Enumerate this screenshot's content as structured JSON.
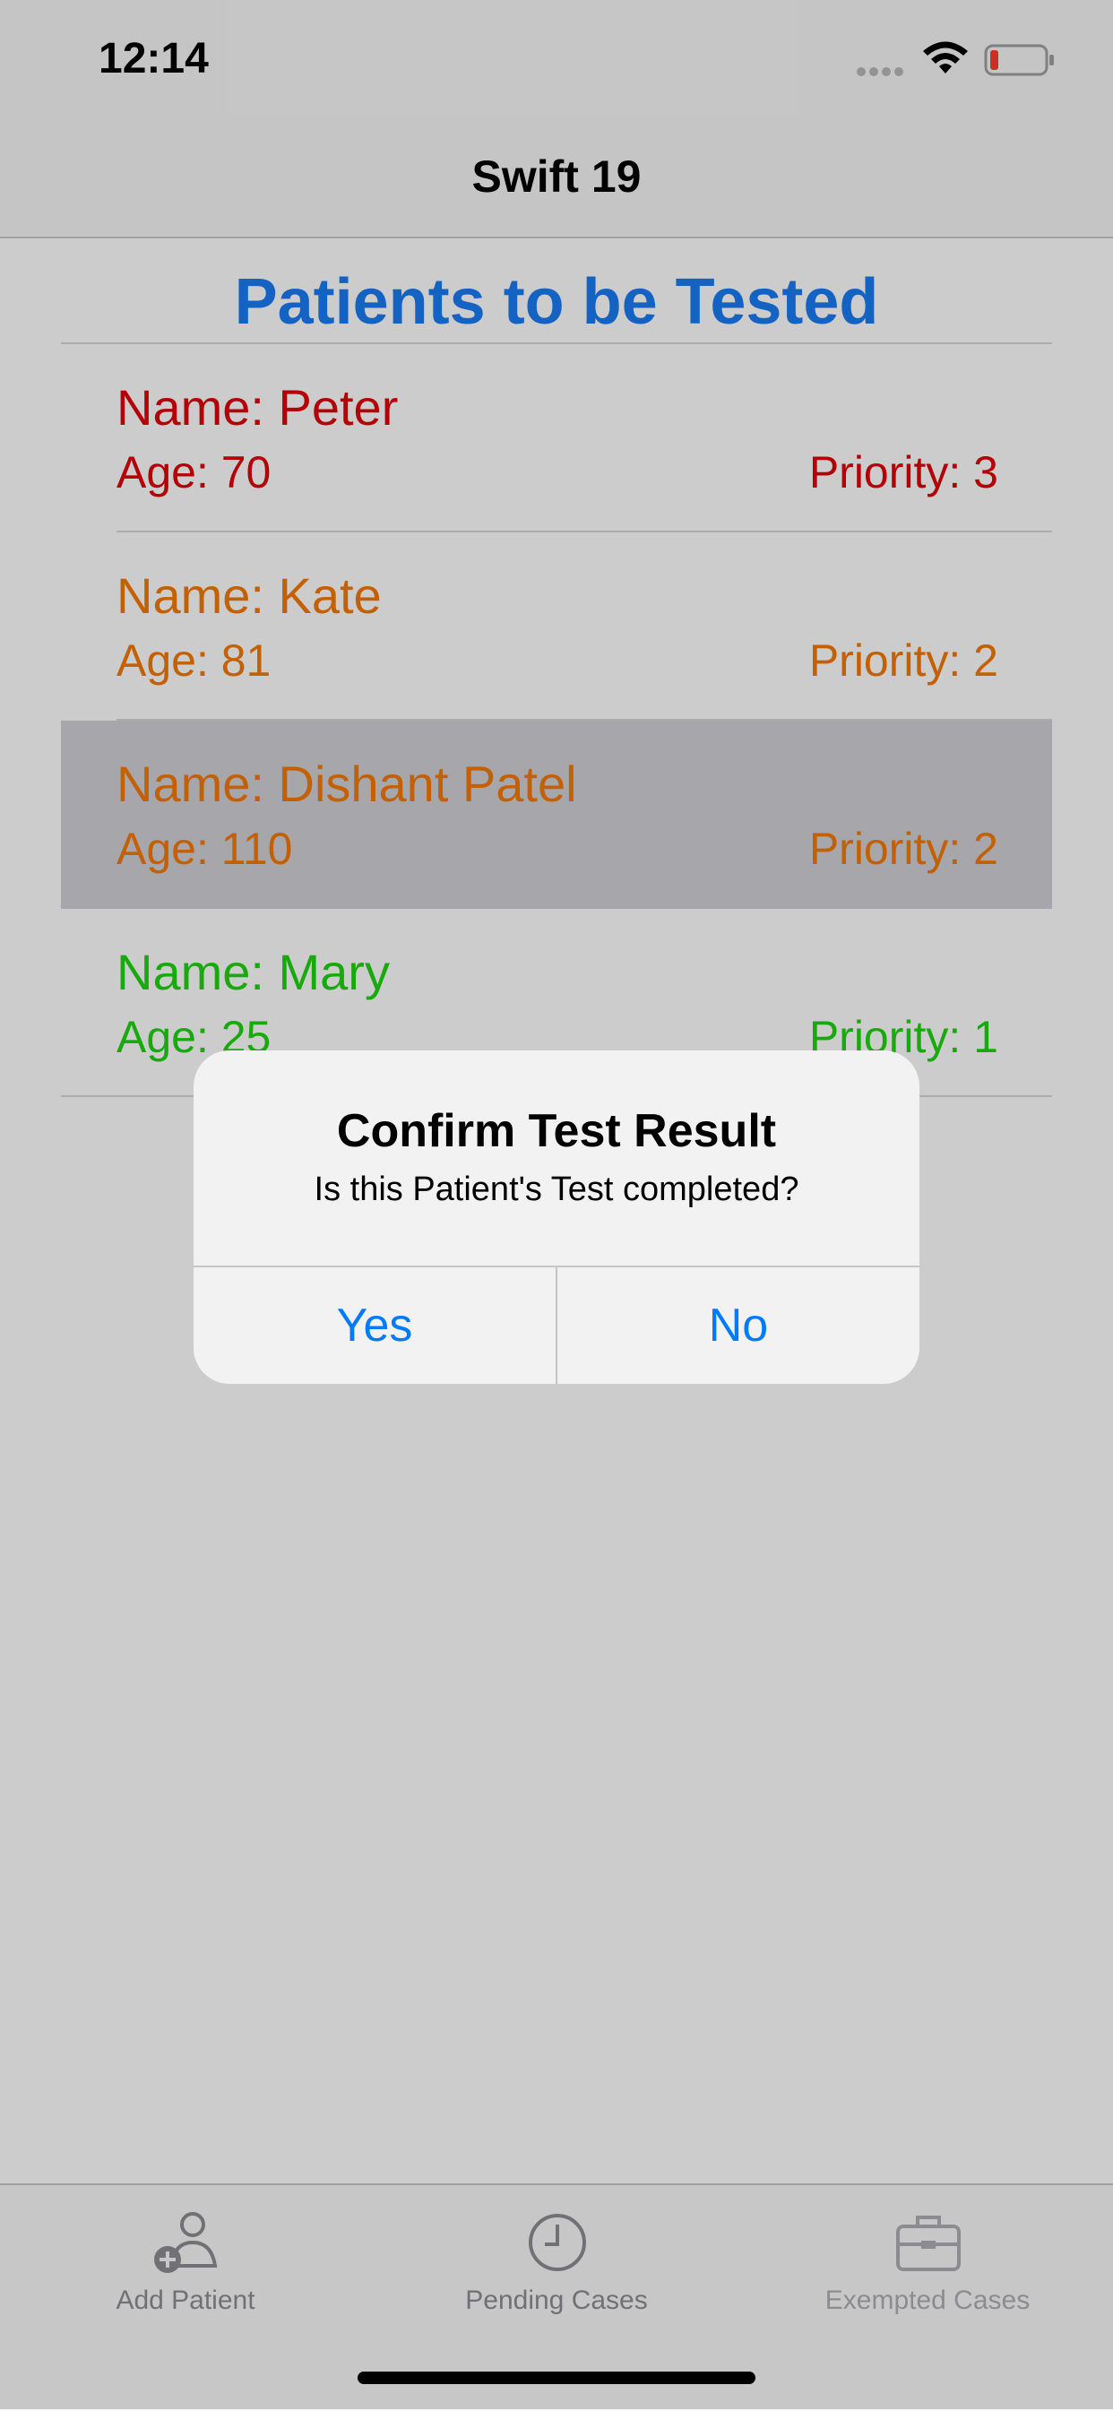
{
  "status_bar": {
    "time": "12:14"
  },
  "nav": {
    "title": "Swift 19"
  },
  "header": {
    "title": "Patients to be Tested",
    "color": "#1a7cf4"
  },
  "patients": [
    {
      "name": "Name: Peter",
      "age": "Age: 70",
      "priority": "Priority: 3",
      "color": "#e0000a",
      "selected": false
    },
    {
      "name": "Name: Kate",
      "age": "Age: 81",
      "priority": "Priority: 2",
      "color": "#f47a00",
      "selected": false
    },
    {
      "name": "Name: Dishant Patel",
      "age": "Age: 110",
      "priority": "Priority: 2",
      "color": "#f47a00",
      "selected": true
    },
    {
      "name": "Name: Mary",
      "age": "Age: 25",
      "priority": "Priority: 1",
      "color": "#1ed510",
      "selected": false
    }
  ],
  "alert": {
    "title": "Confirm Test Result",
    "message": "Is this Patient's Test completed?",
    "yes_label": "Yes",
    "no_label": "No",
    "button_color": "#007aff"
  },
  "tabs": [
    {
      "label": "Add Patient",
      "icon": "add-person-icon",
      "color": "#8e8e93"
    },
    {
      "label": "Pending Cases",
      "icon": "clock-icon",
      "color": "#8e8e93"
    },
    {
      "label": "Exempted Cases",
      "icon": "briefcase-icon",
      "color": "#b0b0b5"
    }
  ]
}
